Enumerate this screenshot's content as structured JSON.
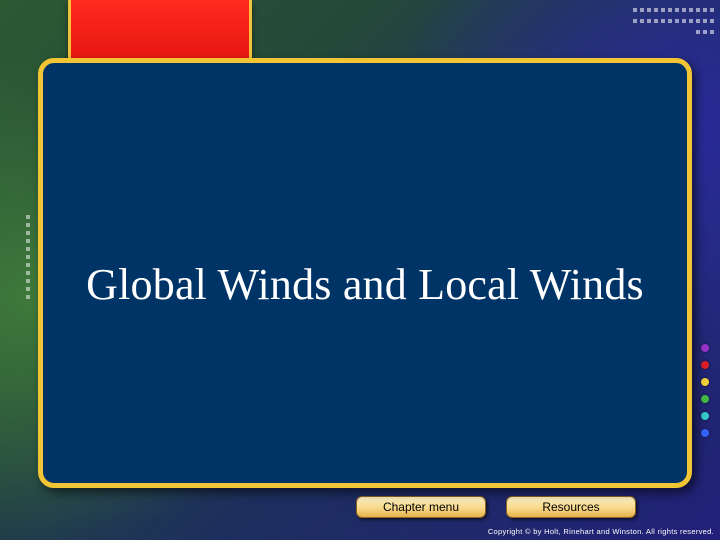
{
  "slide": {
    "title": "Global Winds and Local Winds"
  },
  "nav": {
    "chapter_menu_label": "Chapter menu",
    "resources_label": "Resources"
  },
  "footer": {
    "copyright": "Copyright © by Holt, Rinehart and Winston. All rights reserved."
  },
  "colors": {
    "panel": "#003466",
    "border_gold": "#f2c535",
    "tab_red": "#e0120c",
    "dots": [
      "#9933cc",
      "#e01e2a",
      "#f2d23a",
      "#44bb44",
      "#33cccc",
      "#3366ff"
    ]
  },
  "icons": [
    "decorative-dot-grid",
    "decorative-dot-column",
    "colored-dot-column"
  ]
}
